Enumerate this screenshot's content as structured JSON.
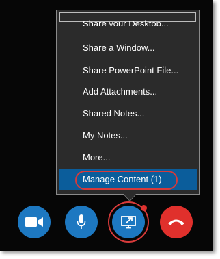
{
  "menu": {
    "items": [
      {
        "label": "Share your Desktop..."
      },
      {
        "label": "Share a Window..."
      },
      {
        "label": "Share PowerPoint File..."
      },
      {
        "label": "Add Attachments..."
      },
      {
        "label": "Shared Notes..."
      },
      {
        "label": "My Notes..."
      },
      {
        "label": "More..."
      }
    ],
    "highlighted": {
      "label": "Manage Content (1)"
    }
  },
  "toolbar": {
    "buttons": [
      {
        "icon": "video-camera-icon",
        "color": "#1d78c1"
      },
      {
        "icon": "microphone-icon",
        "color": "#1d78c1"
      },
      {
        "icon": "share-content-icon",
        "color": "#1d78c1",
        "has_notification": true
      },
      {
        "icon": "hang-up-icon",
        "color": "#e0302c"
      }
    ]
  },
  "colors": {
    "background": "#060606",
    "menu_background": "#2b2b2b",
    "highlight": "#0b5d9b",
    "annotation": "#d63a3a"
  }
}
